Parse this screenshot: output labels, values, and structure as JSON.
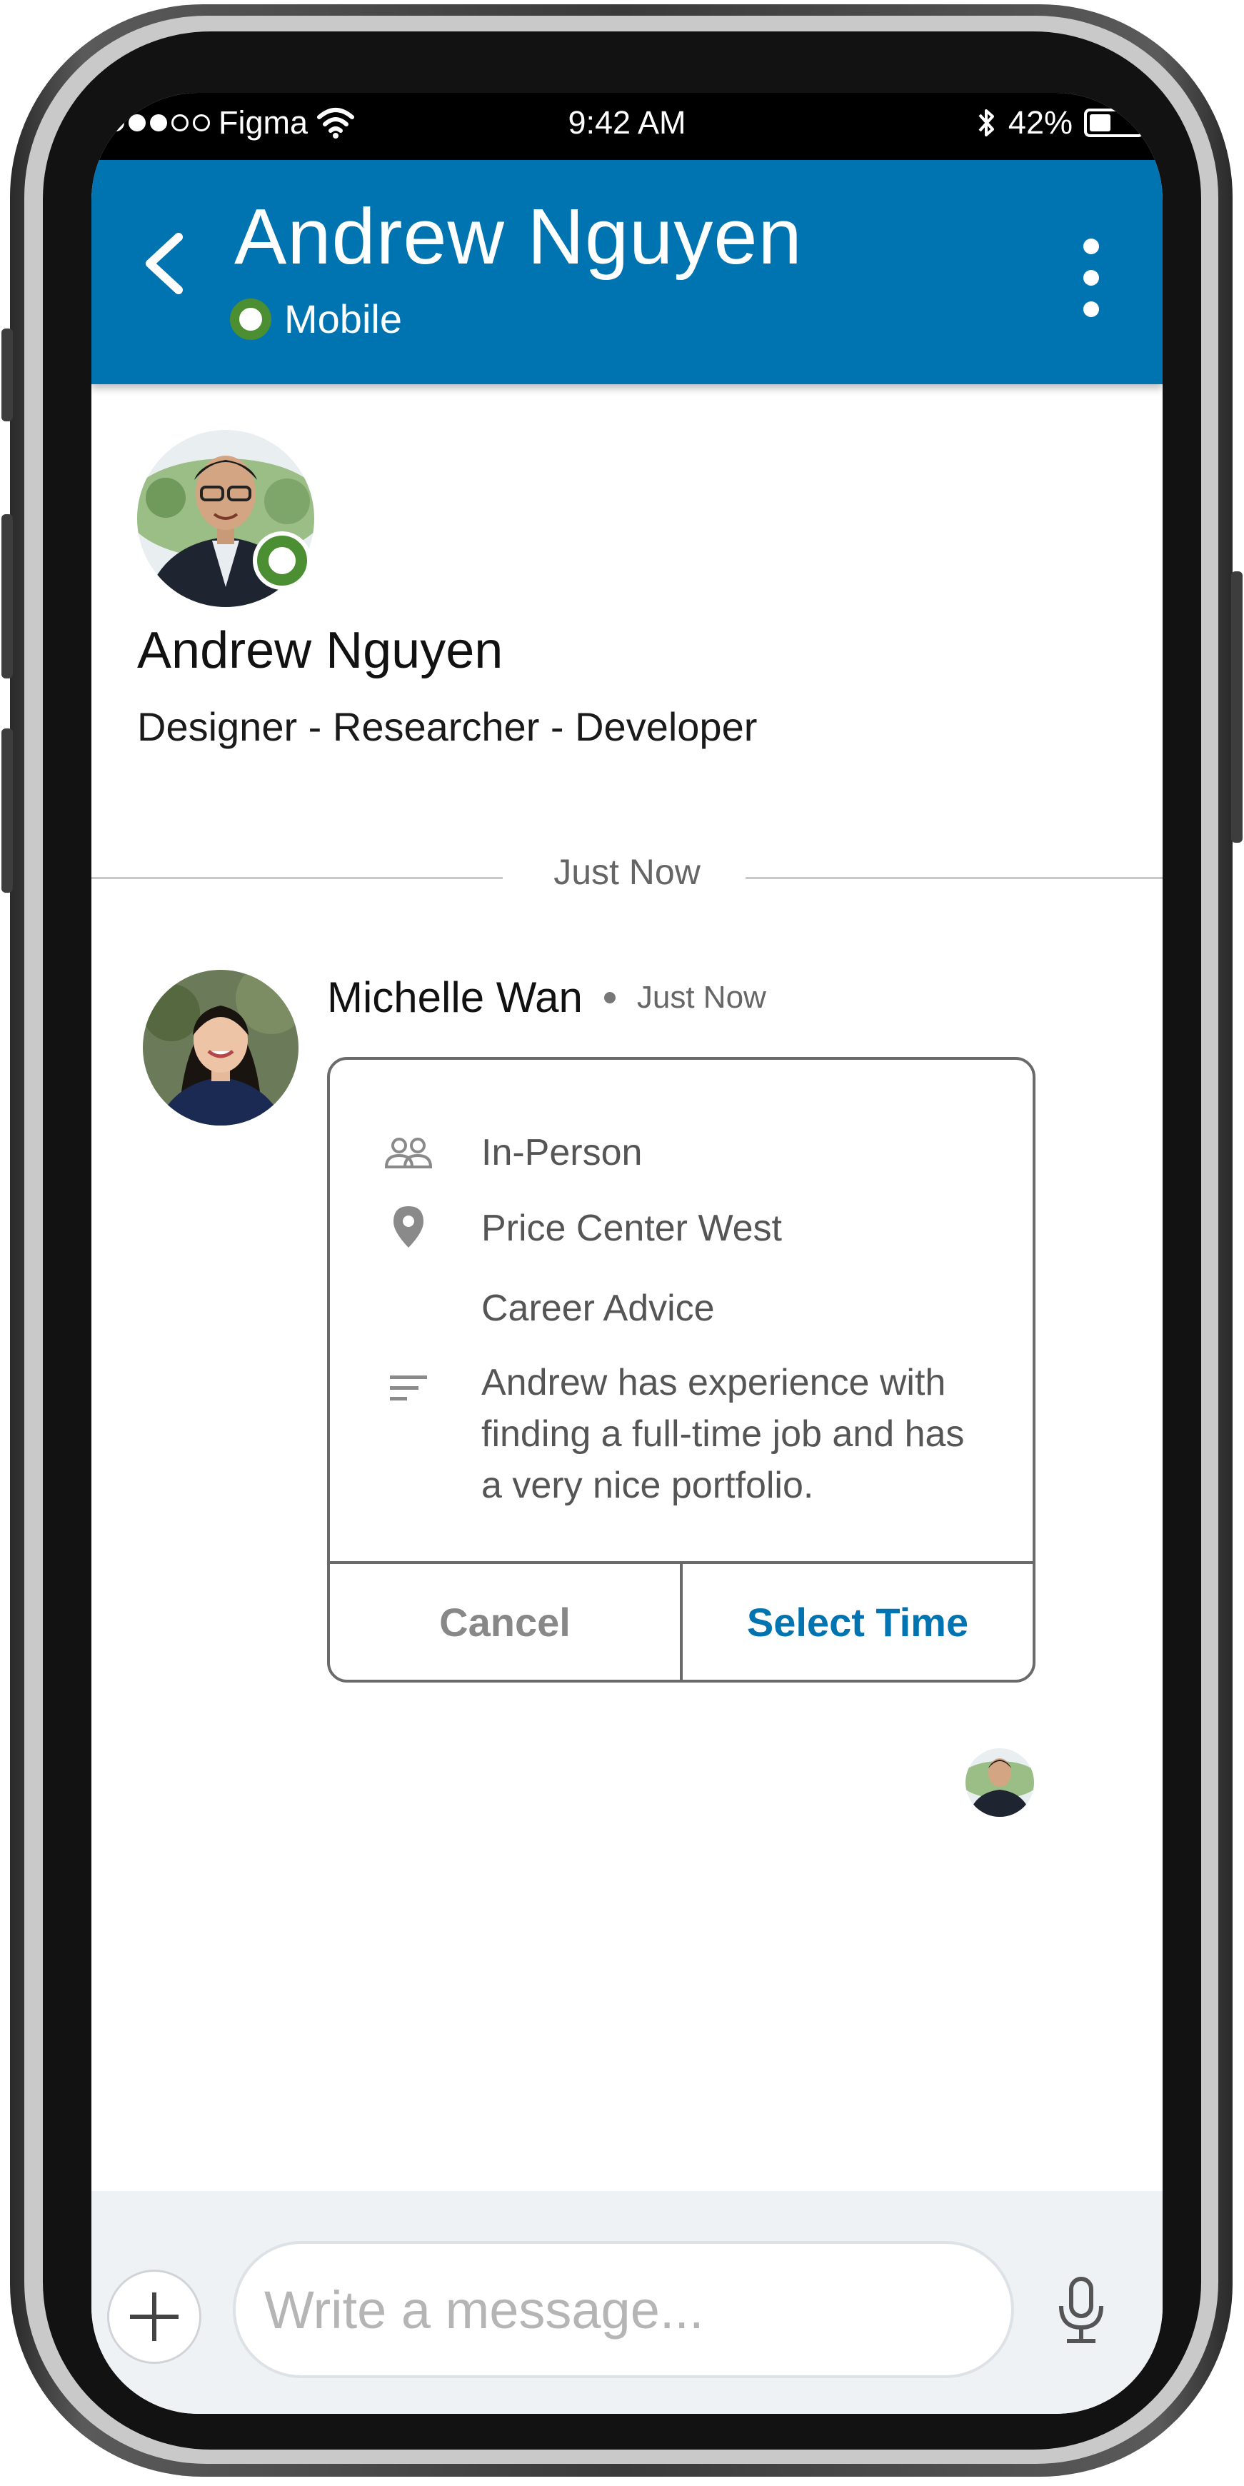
{
  "status_bar": {
    "carrier": "Figma",
    "time": "9:42 AM",
    "battery": "42%",
    "battery_level": 0.42,
    "signal_bars_filled": 3,
    "signal_bars_total": 5
  },
  "header": {
    "title": "Andrew Nguyen",
    "presence": "Mobile",
    "background_color": "#0073b1"
  },
  "profile": {
    "name": "Andrew Nguyen",
    "headline": "Designer - Researcher - Developer"
  },
  "thread": {
    "divider_label": "Just Now"
  },
  "message": {
    "sender": "Michelle Wan",
    "time": "Just Now",
    "card": {
      "meeting_type": "In-Person",
      "location": "Price Center West",
      "topic": "Career Advice",
      "note": "Andrew has experience with finding a full-time job and has a very nice portfolio.",
      "cancel_label": "Cancel",
      "confirm_label": "Select Time"
    }
  },
  "composer": {
    "placeholder": "Write a message..."
  },
  "colors": {
    "brand_blue": "#0073b1",
    "online_green": "#4b8f32"
  }
}
